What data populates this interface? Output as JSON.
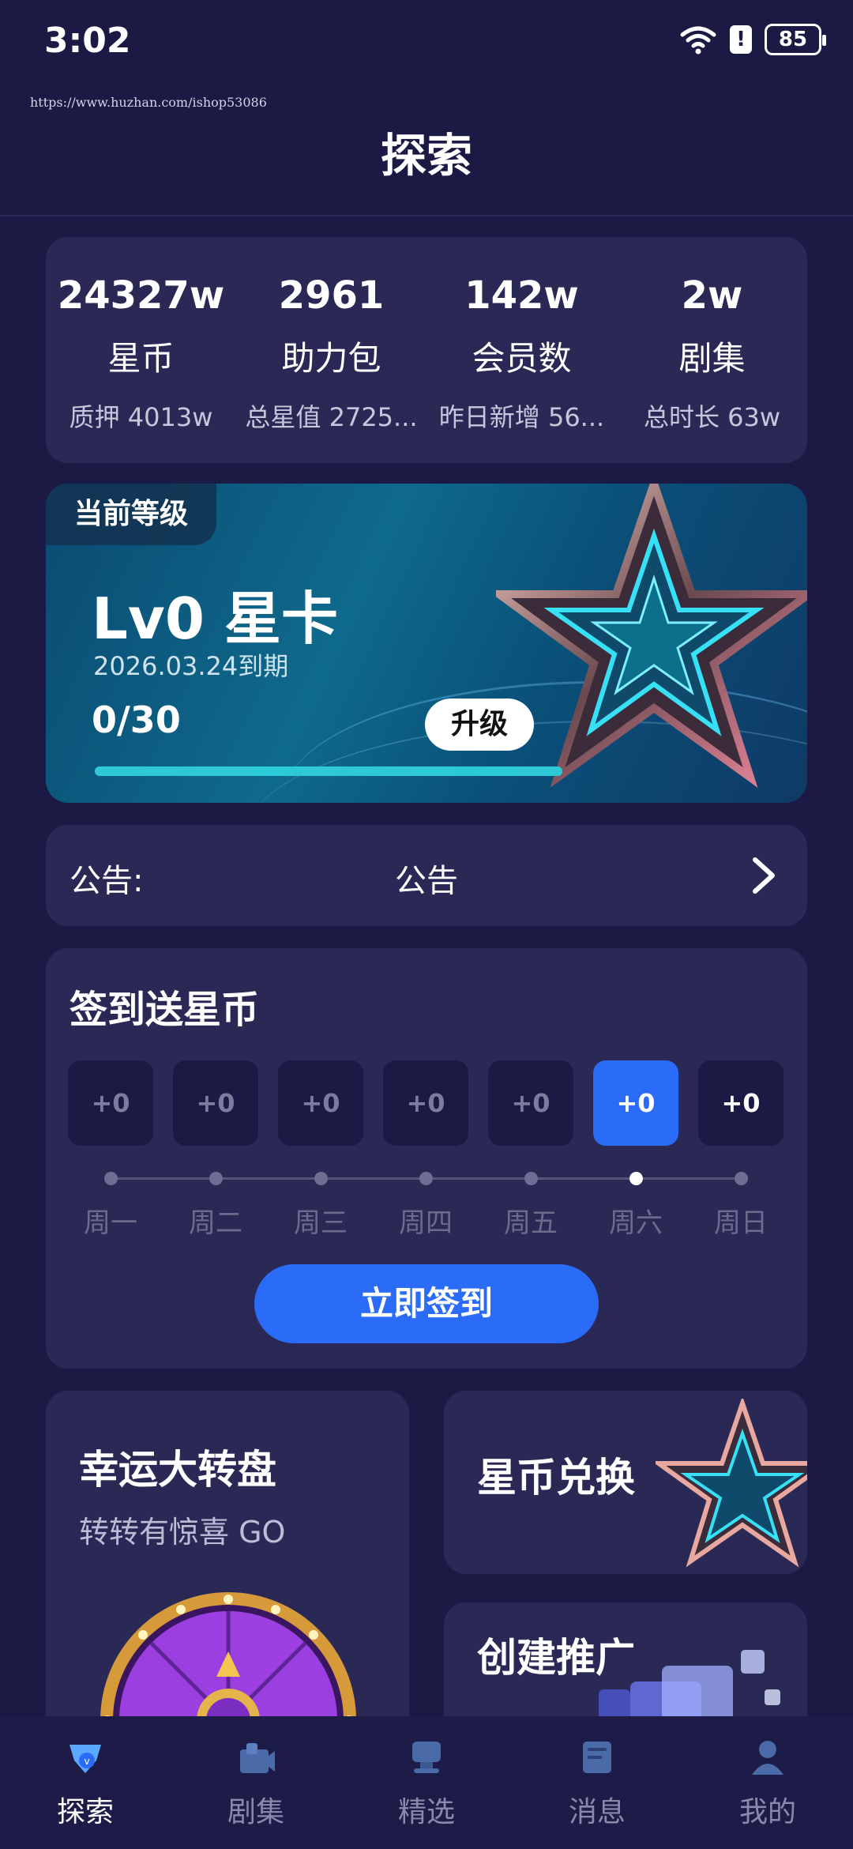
{
  "status_bar": {
    "time": "3:02",
    "battery": "85",
    "alert": "!"
  },
  "watermark": "https://www.huzhan.com/ishop53086",
  "page_title": "探索",
  "stats": [
    {
      "value": "24327w",
      "label": "星币",
      "sub": "质押 4013w"
    },
    {
      "value": "2961",
      "label": "助力包",
      "sub": "总星值 2725..."
    },
    {
      "value": "142w",
      "label": "会员数",
      "sub": "昨日新增 56..."
    },
    {
      "value": "2w",
      "label": "剧集",
      "sub": "总时长 63w"
    }
  ],
  "level": {
    "tag": "当前等级",
    "name": "Lv0 星卡",
    "expire": "2026.03.24到期",
    "progress_text": "0/30",
    "progress_fraction": 0.0,
    "upgrade_label": "升级"
  },
  "notice": {
    "label": "公告:",
    "text": "公告"
  },
  "signin": {
    "title": "签到送星币",
    "days": [
      {
        "reward": "+0",
        "label": "周一"
      },
      {
        "reward": "+0",
        "label": "周二"
      },
      {
        "reward": "+0",
        "label": "周三"
      },
      {
        "reward": "+0",
        "label": "周四"
      },
      {
        "reward": "+0",
        "label": "周五"
      },
      {
        "reward": "+0",
        "label": "周六"
      },
      {
        "reward": "+0",
        "label": "周日"
      }
    ],
    "active_day_index": 5,
    "button_label": "立即签到"
  },
  "features": {
    "wheel": {
      "title": "幸运大转盘",
      "subtitle": "转转有惊喜 GO"
    },
    "exchange": {
      "title": "星币兑换"
    },
    "promo": {
      "title": "创建推广"
    }
  },
  "tabs": [
    {
      "label": "探索",
      "icon": "explore-icon"
    },
    {
      "label": "剧集",
      "icon": "series-icon"
    },
    {
      "label": "精选",
      "icon": "featured-icon"
    },
    {
      "label": "消息",
      "icon": "message-icon"
    },
    {
      "label": "我的",
      "icon": "profile-icon"
    }
  ],
  "active_tab_index": 0,
  "colors": {
    "background": "#1b1a44",
    "card": "#2a2955",
    "accent": "#2a6cf7",
    "progress": "#2ec9d8"
  }
}
